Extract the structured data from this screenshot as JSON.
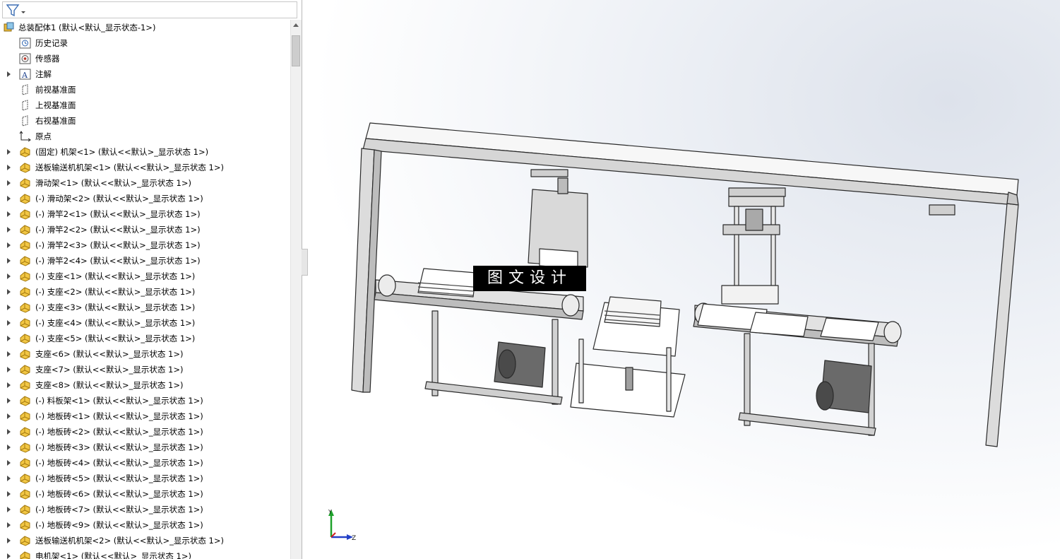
{
  "feature_tree": {
    "root": {
      "label": "总装配体1 (默认<默认_显示状态-1>)",
      "icon": "assembly-icon"
    },
    "items": [
      {
        "label": "历史记录",
        "icon": "history-icon",
        "expandable": false
      },
      {
        "label": "传感器",
        "icon": "sensor-icon",
        "expandable": false
      },
      {
        "label": "注解",
        "icon": "annotation-icon",
        "expandable": true
      },
      {
        "label": "前视基准面",
        "icon": "plane-icon",
        "expandable": false
      },
      {
        "label": "上视基准面",
        "icon": "plane-icon",
        "expandable": false
      },
      {
        "label": "右视基准面",
        "icon": "plane-icon",
        "expandable": false
      },
      {
        "label": "原点",
        "icon": "origin-icon",
        "expandable": false
      },
      {
        "label": "(固定) 机架<1> (默认<<默认>_显示状态 1>)",
        "icon": "part-icon",
        "expandable": true
      },
      {
        "label": "送板输送机机架<1> (默认<<默认>_显示状态 1>)",
        "icon": "part-icon",
        "expandable": true
      },
      {
        "label": "滑动架<1> (默认<<默认>_显示状态 1>)",
        "icon": "part-icon",
        "expandable": true
      },
      {
        "label": "(-) 滑动架<2> (默认<<默认>_显示状态 1>)",
        "icon": "part-icon",
        "expandable": true
      },
      {
        "label": "(-) 滑竿2<1> (默认<<默认>_显示状态 1>)",
        "icon": "part-icon",
        "expandable": true
      },
      {
        "label": "(-) 滑竿2<2> (默认<<默认>_显示状态 1>)",
        "icon": "part-icon",
        "expandable": true
      },
      {
        "label": "(-) 滑竿2<3> (默认<<默认>_显示状态 1>)",
        "icon": "part-icon",
        "expandable": true
      },
      {
        "label": "(-) 滑竿2<4> (默认<<默认>_显示状态 1>)",
        "icon": "part-icon",
        "expandable": true
      },
      {
        "label": "(-) 支座<1> (默认<<默认>_显示状态 1>)",
        "icon": "part-icon",
        "expandable": true
      },
      {
        "label": "(-) 支座<2> (默认<<默认>_显示状态 1>)",
        "icon": "part-icon",
        "expandable": true
      },
      {
        "label": "(-) 支座<3> (默认<<默认>_显示状态 1>)",
        "icon": "part-icon",
        "expandable": true
      },
      {
        "label": "(-) 支座<4> (默认<<默认>_显示状态 1>)",
        "icon": "part-icon",
        "expandable": true
      },
      {
        "label": "(-) 支座<5> (默认<<默认>_显示状态 1>)",
        "icon": "part-icon",
        "expandable": true
      },
      {
        "label": "支座<6> (默认<<默认>_显示状态 1>)",
        "icon": "part-icon",
        "expandable": true
      },
      {
        "label": "支座<7> (默认<<默认>_显示状态 1>)",
        "icon": "part-icon",
        "expandable": true
      },
      {
        "label": "支座<8> (默认<<默认>_显示状态 1>)",
        "icon": "part-icon",
        "expandable": true
      },
      {
        "label": "(-) 料板架<1> (默认<<默认>_显示状态 1>)",
        "icon": "part-icon",
        "expandable": true
      },
      {
        "label": "(-) 地板砖<1> (默认<<默认>_显示状态 1>)",
        "icon": "part-icon",
        "expandable": true
      },
      {
        "label": "(-) 地板砖<2> (默认<<默认>_显示状态 1>)",
        "icon": "part-icon",
        "expandable": true
      },
      {
        "label": "(-) 地板砖<3> (默认<<默认>_显示状态 1>)",
        "icon": "part-icon",
        "expandable": true
      },
      {
        "label": "(-) 地板砖<4> (默认<<默认>_显示状态 1>)",
        "icon": "part-icon",
        "expandable": true
      },
      {
        "label": "(-) 地板砖<5> (默认<<默认>_显示状态 1>)",
        "icon": "part-icon",
        "expandable": true
      },
      {
        "label": "(-) 地板砖<6> (默认<<默认>_显示状态 1>)",
        "icon": "part-icon",
        "expandable": true
      },
      {
        "label": "(-) 地板砖<7> (默认<<默认>_显示状态 1>)",
        "icon": "part-icon",
        "expandable": true
      },
      {
        "label": "(-) 地板砖<9> (默认<<默认>_显示状态 1>)",
        "icon": "part-icon",
        "expandable": true
      },
      {
        "label": "送板输送机机架<2> (默认<<默认>_显示状态 1>)",
        "icon": "part-icon",
        "expandable": true
      },
      {
        "label": "电机架<1> (默认<<默认>_显示状态 1>)",
        "icon": "part-icon",
        "expandable": true
      }
    ]
  },
  "viewport": {
    "watermark": "图文设计",
    "triad": {
      "y_label": "Y",
      "z_label": "Z"
    }
  },
  "colors": {
    "part_icon": "#f2c744",
    "part_icon_outline": "#a47a10",
    "assembly_icon": "#e9b93a",
    "axis_y": "#1ea12b",
    "axis_z": "#2340c8",
    "axis_x": "#d12020"
  }
}
